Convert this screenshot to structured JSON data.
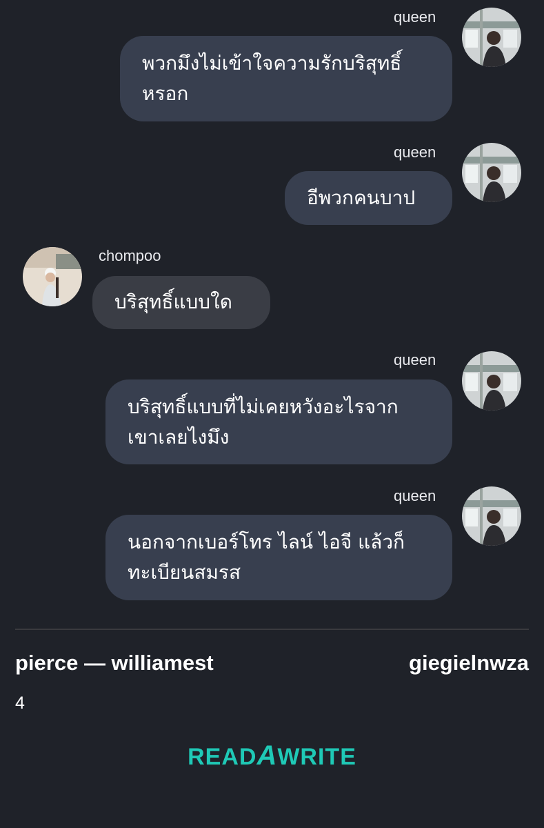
{
  "messages": [
    {
      "sender": "queen",
      "line1": "พวกมึงไม่เข้าใจความรักบริสุทธิ์",
      "line2": "หรอก"
    },
    {
      "sender": "queen",
      "line1": "อีพวกคนบาป",
      "line2": ""
    },
    {
      "sender": "chompoo",
      "line1": "บริสุทธิ์แบบใด",
      "line2": ""
    },
    {
      "sender": "queen",
      "line1": "บริสุทธิ์แบบที่ไม่เคยหวังอะไรจาก",
      "line2": "เขาเลยไงมึง"
    },
    {
      "sender": "queen",
      "line1": "นอกจากเบอร์โทร ไลน์ ไอจี แล้วก็",
      "line2": "ทะเบียนสมรส"
    }
  ],
  "footer": {
    "title": "pierce — williamest",
    "author": "giegielnwza",
    "page": "4"
  },
  "logo": {
    "part1": "READ",
    "part2": "A",
    "part3": "WRITE",
    "color": "#1fc9b6"
  },
  "colors": {
    "background": "#1f2229",
    "bubble_right": "#383f4f",
    "bubble_left": "#3a3d45"
  },
  "icons": {
    "avatar_queen": "avatar-icon",
    "avatar_chompoo": "avatar-icon"
  }
}
